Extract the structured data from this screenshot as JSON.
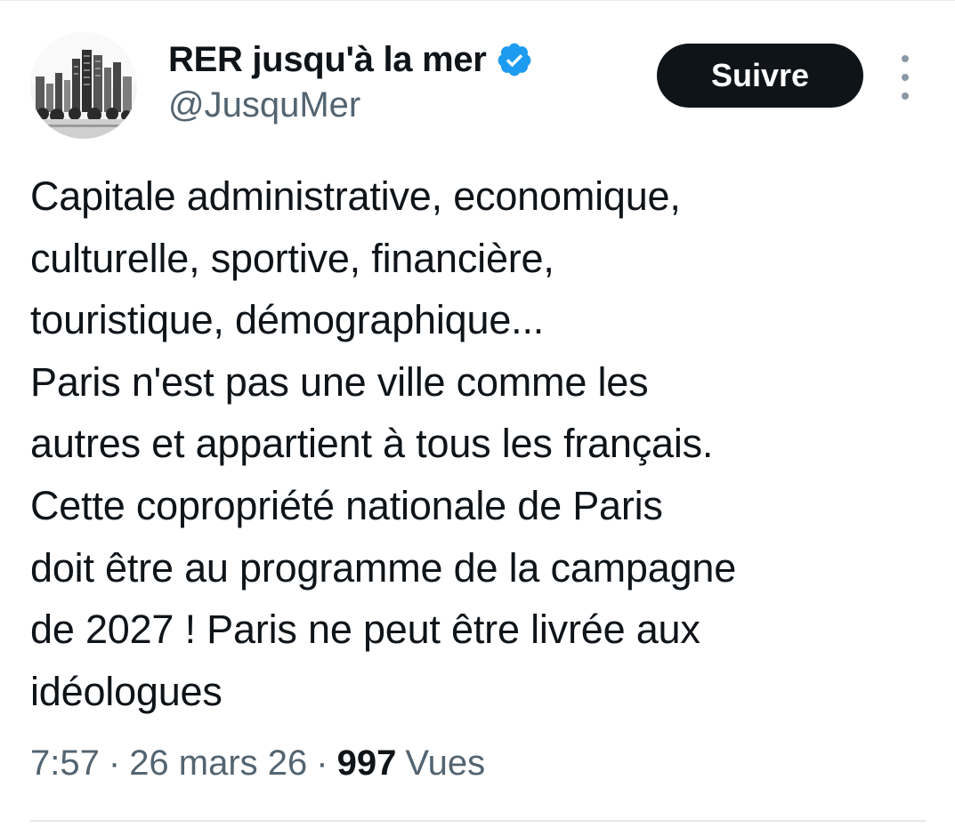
{
  "author": {
    "display_name": "RER jusqu'à la mer",
    "handle": "@JusquMer",
    "verified": true,
    "avatar_icon": "city-skyline-avatar",
    "verified_icon": "verified-badge-icon",
    "verified_color": "#1d9bf0"
  },
  "actions": {
    "follow_label": "Suivre",
    "more_icon": "more-vertical-icon"
  },
  "tweet": {
    "text": "Capitale administrative, economique,\nculturelle, sportive, financière,\ntouristique, démographique...\nParis n'est pas une ville comme les\nautres et appartient à tous les français.\nCette copropriété nationale de Paris\ndoit être au programme de la campagne\nde 2027 ! Paris ne peut être livrée aux\nidéologues"
  },
  "meta": {
    "time": "7:57",
    "separator": "·",
    "date": "26 mars 26",
    "views_count": "997",
    "views_label": "Vues"
  },
  "colors": {
    "text_primary": "#0f1419",
    "text_secondary": "#536471",
    "button_bg": "#0f1419",
    "divider": "#e7e9ea"
  }
}
